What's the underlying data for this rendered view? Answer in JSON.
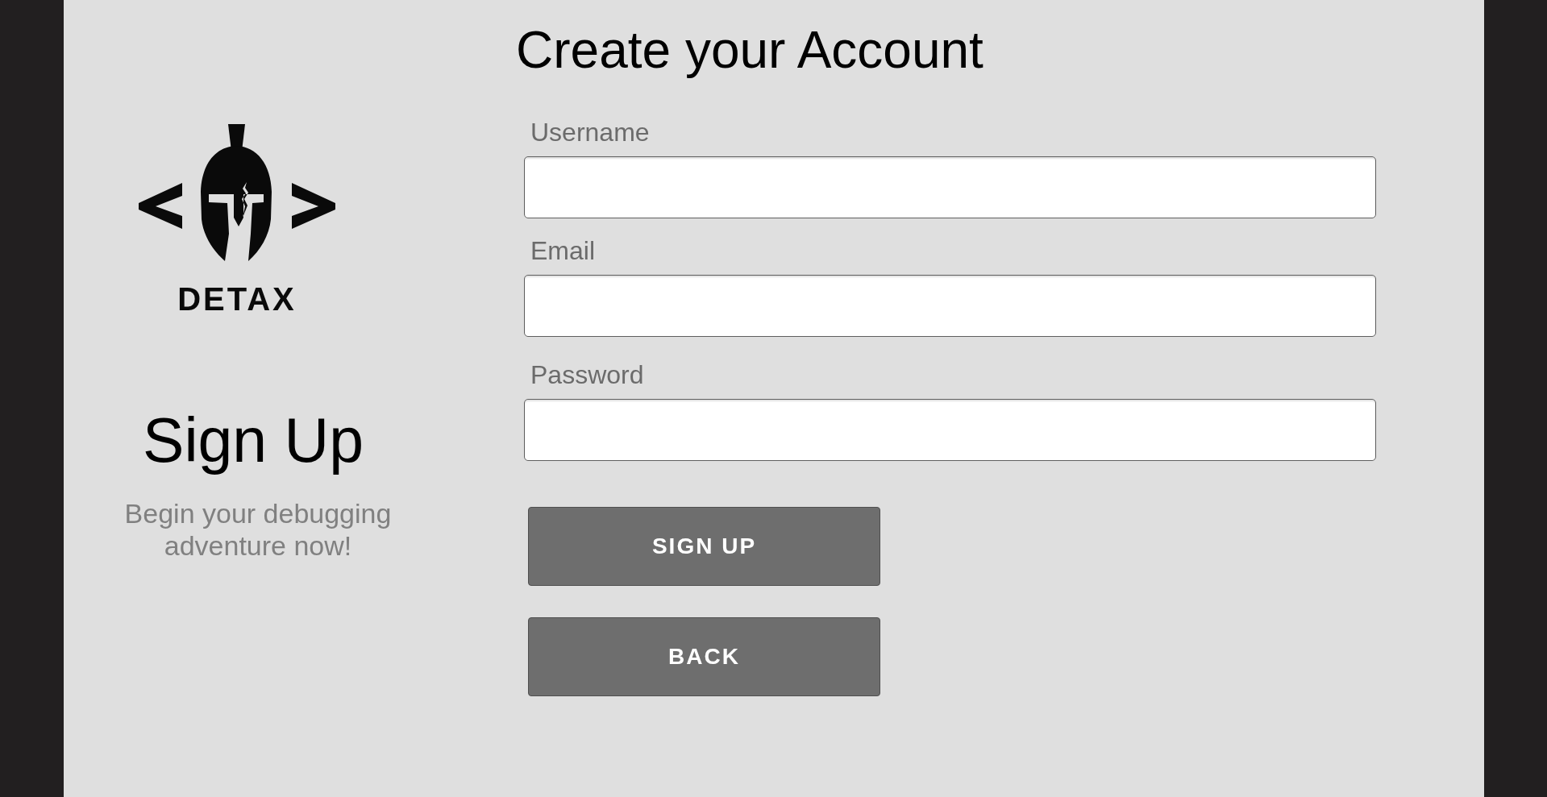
{
  "logo": {
    "text": "DETAX"
  },
  "intro": {
    "heading": "Sign Up",
    "tagline": "Begin your debugging adventure now!"
  },
  "form": {
    "title": "Create your Account",
    "fields": [
      {
        "label": "Username"
      },
      {
        "label": "Email"
      },
      {
        "label": "Password"
      }
    ],
    "buttons": [
      {
        "label": "SIGN UP"
      },
      {
        "label": "BACK"
      }
    ]
  }
}
